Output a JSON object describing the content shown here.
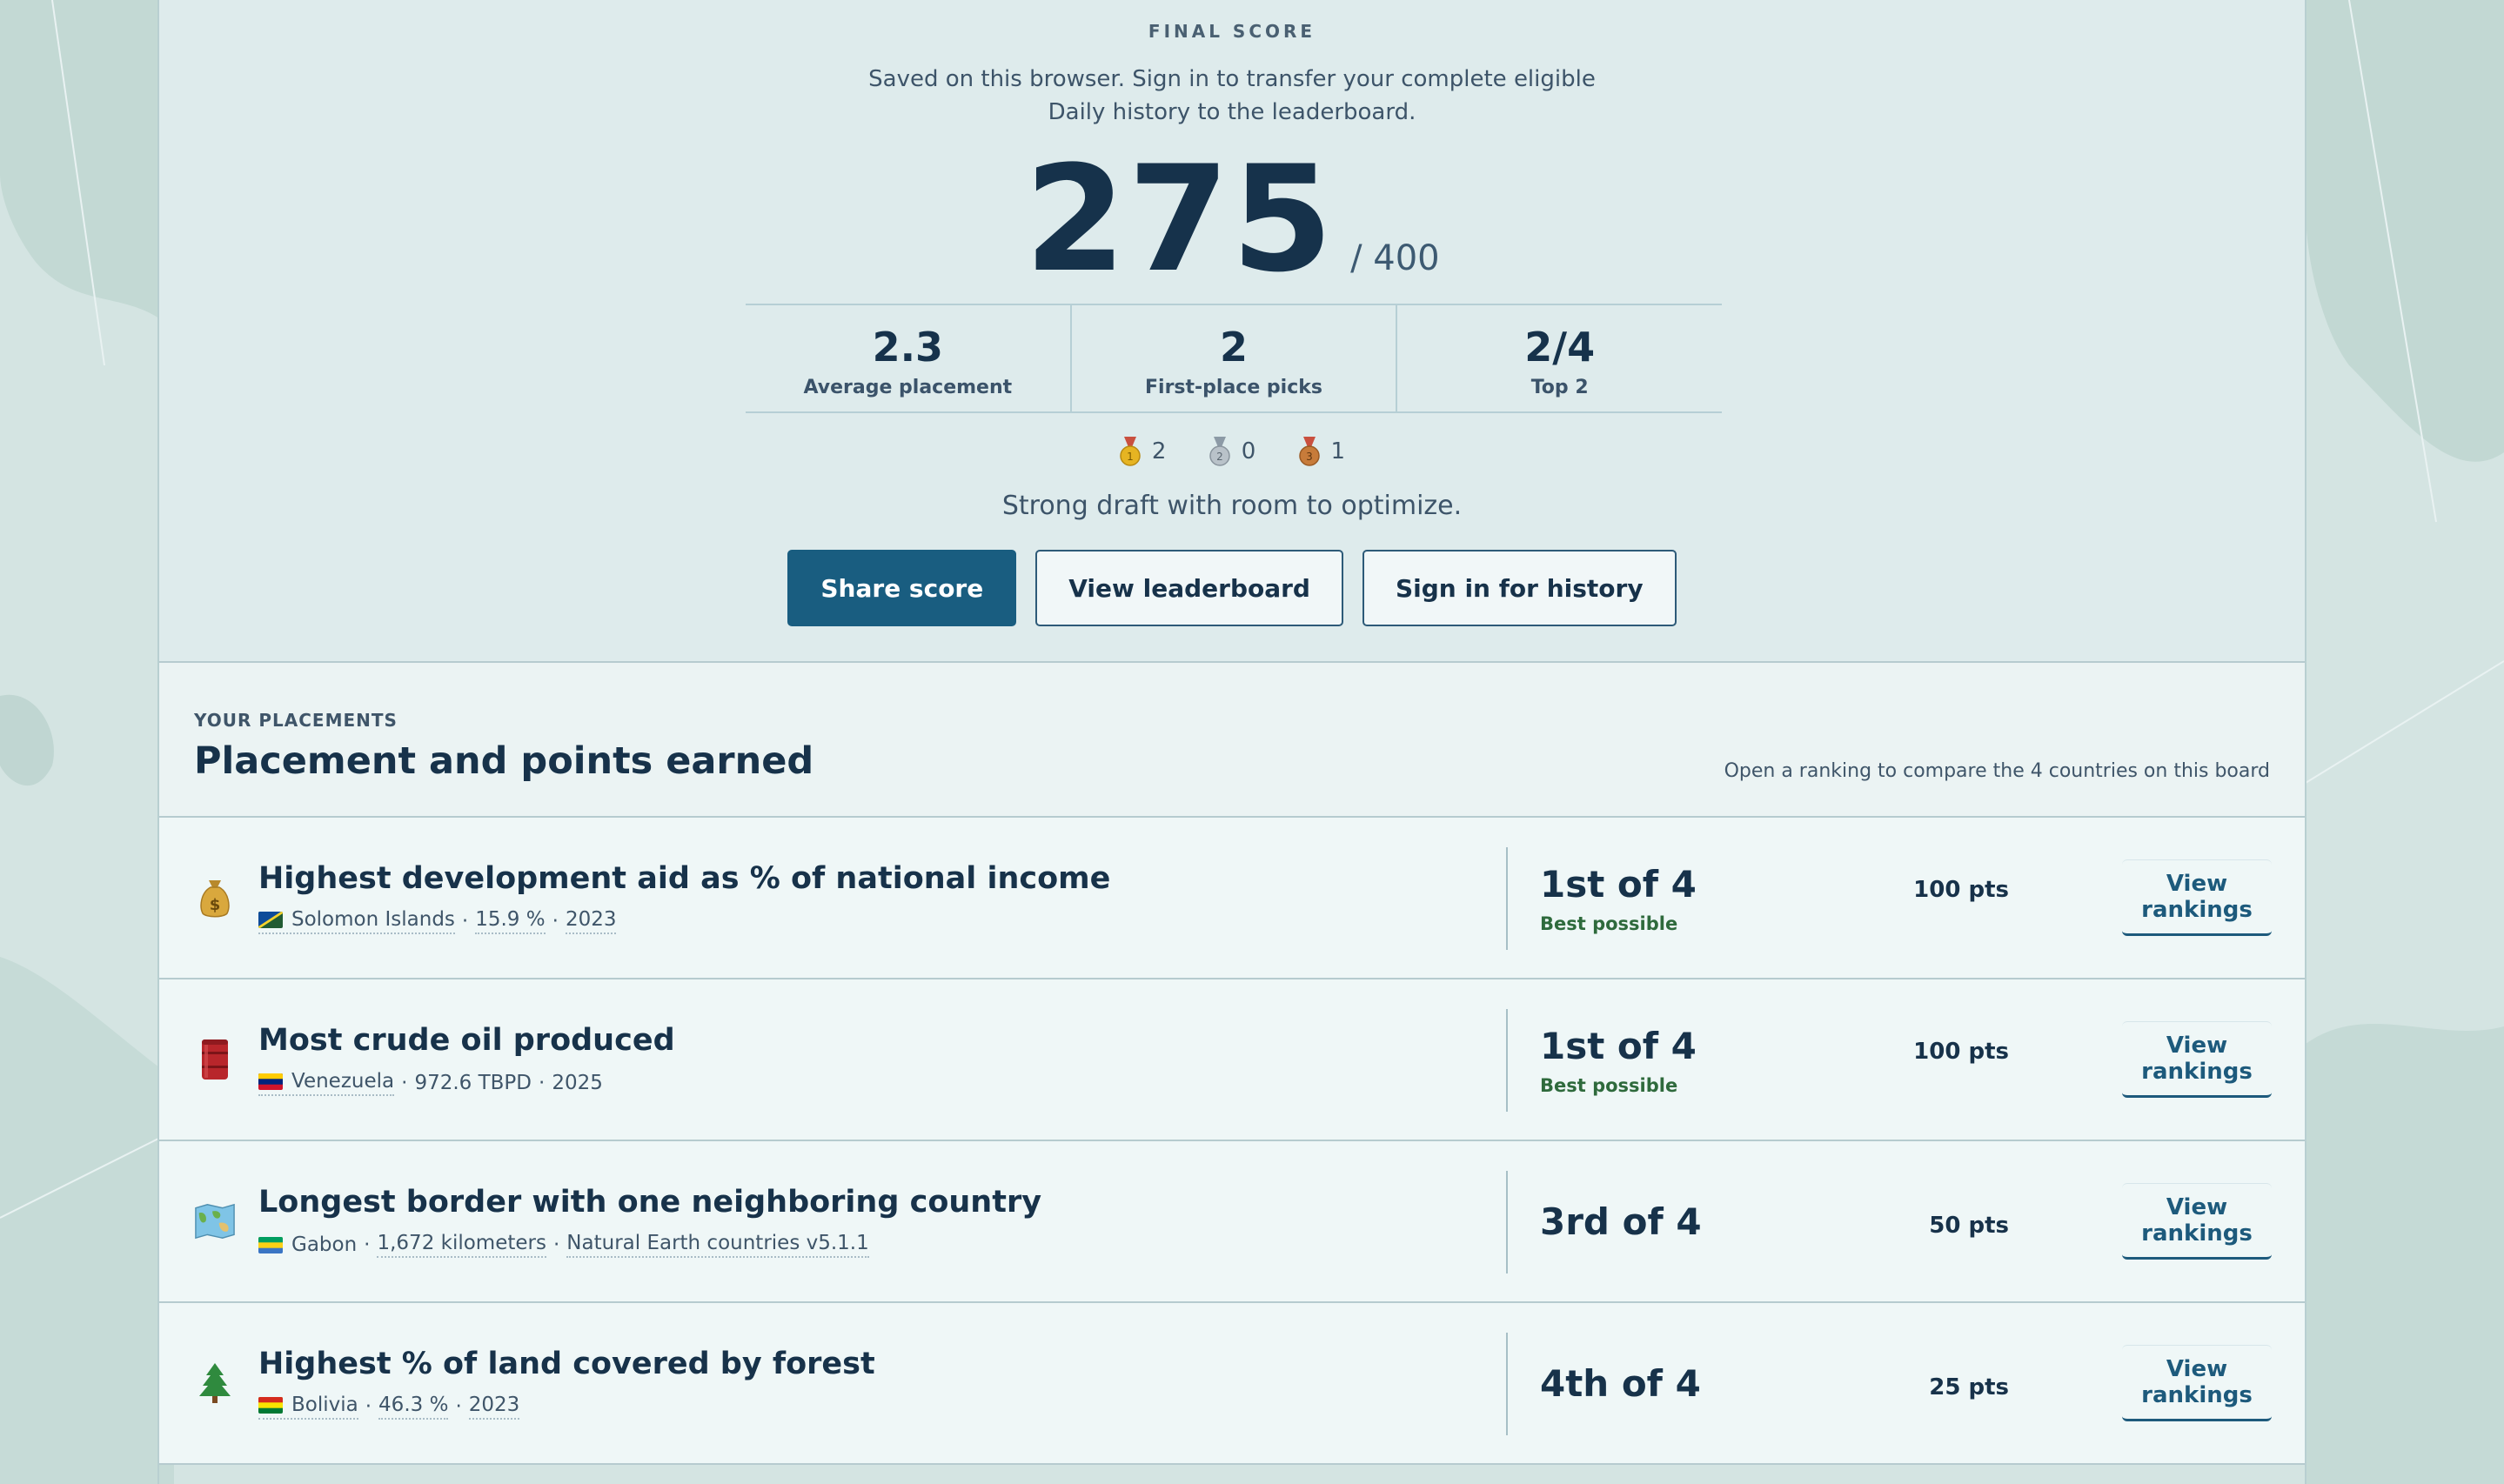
{
  "score": {
    "eyebrow": "FINAL SCORE",
    "saved_note": "Saved on this browser. Sign in to transfer your complete eligible Daily history to the leaderboard.",
    "value": "275",
    "out_of": "/ 400"
  },
  "stats": [
    {
      "value": "2.3",
      "label": "Average placement"
    },
    {
      "value": "2",
      "label": "First-place picks"
    },
    {
      "value": "2/4",
      "label": "Top 2"
    }
  ],
  "medals": {
    "gold": "2",
    "silver": "0",
    "bronze": "1"
  },
  "verdict": "Strong draft with room to optimize.",
  "actions": {
    "share": "Share score",
    "leaderboard": "View leaderboard",
    "signin": "Sign in for history"
  },
  "placements": {
    "eyebrow": "YOUR PLACEMENTS",
    "title": "Placement and points earned",
    "hint": "Open a ranking to compare the 4 countries on this board",
    "rows": [
      {
        "icon": "money-bag-icon",
        "title": "Highest development aid as % of national income",
        "country": "Solomon Islands",
        "value": "15.9 %",
        "source": "2023",
        "place": "1st of 4",
        "note": "Best possible",
        "points": "100 pts",
        "action": "View rankings"
      },
      {
        "icon": "oil-barrel-icon",
        "title": "Most crude oil produced",
        "country": "Venezuela",
        "value": "972.6 TBPD",
        "source": "2025",
        "place": "1st of 4",
        "note": "Best possible",
        "points": "100 pts",
        "action": "View rankings"
      },
      {
        "icon": "world-map-icon",
        "title": "Longest border with one neighboring country",
        "country": "Gabon",
        "value": "1,672 kilometers",
        "source": "Natural Earth countries v5.1.1",
        "place": "3rd of 4",
        "note": "",
        "points": "50 pts",
        "action": "View rankings"
      },
      {
        "icon": "evergreen-tree-icon",
        "title": "Highest % of land covered by forest",
        "country": "Bolivia",
        "value": "46.3 %",
        "source": "2023",
        "place": "4th of 4",
        "note": "",
        "points": "25 pts",
        "action": "View rankings"
      }
    ]
  },
  "colors": {
    "primary": "#195d80",
    "ink": "#17324a",
    "positive": "#2e6a3c"
  }
}
